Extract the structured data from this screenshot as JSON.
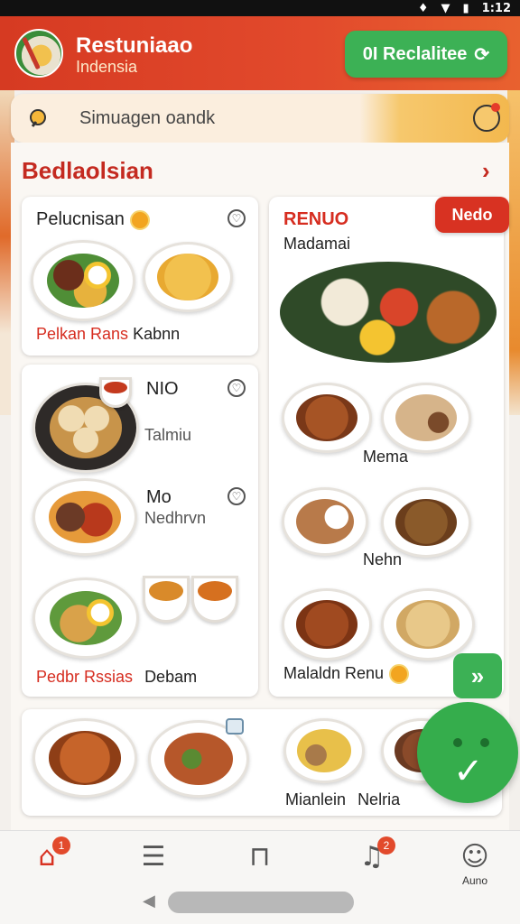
{
  "status_bar": {
    "time": "1:12"
  },
  "header": {
    "app_name": "Restuniaao",
    "app_subtitle": "Indensia",
    "action_button_label": "0I Reclalitee"
  },
  "search": {
    "placeholder": "Simuagen oandk"
  },
  "section": {
    "title": "Bedlaolsian"
  },
  "cards": {
    "card1": {
      "title": "Pelucnisan",
      "caption_red": "Pelkan Rans",
      "caption_black": "Kabnn"
    },
    "card2": {
      "title": "NIO",
      "subtitle": "Talmiu"
    },
    "card3": {
      "title": "Mo",
      "subtitle": "Nedhrvn"
    },
    "card4": {
      "caption_red": "Pedbr Rssias",
      "caption_black": "Debam"
    },
    "menu": {
      "title": "RENUO",
      "subtitle": "Madamai",
      "badge": "Nedo",
      "dish_label_1": "Mema",
      "dish_label_2": "Nehn",
      "footer": "Malaldn Renu"
    },
    "bottom": {
      "caption_1": "Mianlein",
      "caption_2": "Nelria"
    }
  },
  "bottom_nav": {
    "items": [
      {
        "icon": "home-icon",
        "badge": "1"
      },
      {
        "icon": "layers-icon"
      },
      {
        "icon": "bag-icon"
      },
      {
        "icon": "bell-icon",
        "badge": "2"
      },
      {
        "icon": "profile-icon",
        "label": "Auno"
      }
    ]
  },
  "colors": {
    "primary_red": "#d83222",
    "accent_green": "#3cb155",
    "background": "#f3f0ec"
  }
}
